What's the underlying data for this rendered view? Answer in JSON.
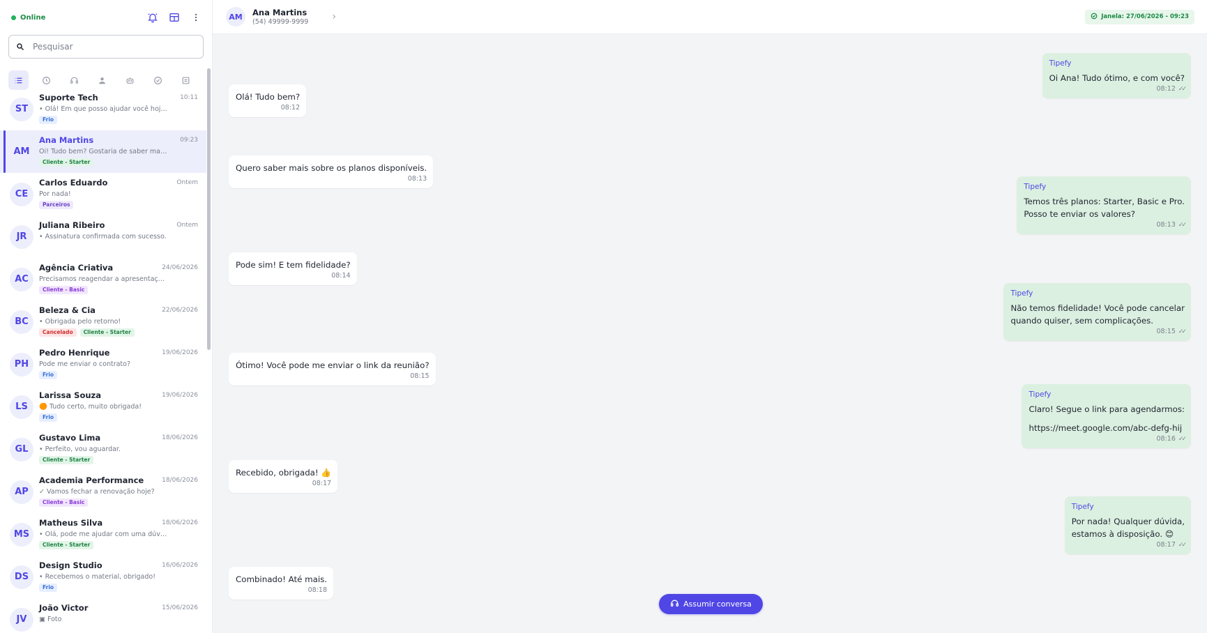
{
  "sidebar": {
    "status_label": "Online",
    "search_placeholder": "Pesquisar",
    "filter_icons": [
      "list-icon",
      "clock-icon",
      "headset-icon",
      "user-icon",
      "bot-icon",
      "check-circle-icon",
      "archive-icon"
    ],
    "conversations": [
      {
        "initials": "ST",
        "name": "Suporte Tech",
        "time": "10:11",
        "preview": "• Olá! Em que posso ajudar você hoje?",
        "tags": [
          {
            "label": "Frio",
            "kind": "frio"
          }
        ]
      },
      {
        "initials": "AM",
        "name": "Ana Martins",
        "time": "09:23",
        "preview": "Oi! Tudo bem? Gostaria de saber mais...",
        "tags": [
          {
            "label": "Cliente - Starter",
            "kind": "starter"
          }
        ],
        "active": true
      },
      {
        "initials": "CE",
        "name": "Carlos Eduardo",
        "time": "Ontem",
        "preview": "Por nada!",
        "tags": [
          {
            "label": "Parceiros",
            "kind": "parc"
          }
        ]
      },
      {
        "initials": "JR",
        "name": "Juliana Ribeiro",
        "time": "Ontem",
        "preview": "• Assinatura confirmada com sucesso.",
        "tags": []
      },
      {
        "initials": "AC",
        "name": "Agência Criativa",
        "time": "24/06/2026",
        "preview": "Precisamos reagendar a apresentação.",
        "tags": [
          {
            "label": "Cliente - Basic",
            "kind": "basic"
          }
        ]
      },
      {
        "initials": "BC",
        "name": "Beleza & Cia",
        "time": "22/06/2026",
        "preview": "• Obrigada pelo retorno!",
        "tags": [
          {
            "label": "Cancelado",
            "kind": "canc"
          },
          {
            "label": "Cliente - Starter",
            "kind": "starter"
          }
        ]
      },
      {
        "initials": "PH",
        "name": "Pedro Henrique",
        "time": "19/06/2026",
        "preview": "Pode me enviar o contrato?",
        "tags": [
          {
            "label": "Frio",
            "kind": "frio"
          }
        ]
      },
      {
        "initials": "LS",
        "name": "Larissa Souza",
        "time": "19/06/2026",
        "preview": "🟠 Tudo certo, muito obrigada!",
        "tags": [
          {
            "label": "Frio",
            "kind": "frio"
          }
        ]
      },
      {
        "initials": "GL",
        "name": "Gustavo Lima",
        "time": "18/06/2026",
        "preview": "• Perfeito, vou aguardar.",
        "tags": [
          {
            "label": "Cliente - Starter",
            "kind": "starter"
          }
        ]
      },
      {
        "initials": "AP",
        "name": "Academia Performance",
        "time": "18/06/2026",
        "preview": "✓ Vamos fechar a renovação hoje?",
        "tags": [
          {
            "label": "Cliente - Basic",
            "kind": "basic"
          }
        ]
      },
      {
        "initials": "MS",
        "name": "Matheus Silva",
        "time": "18/06/2026",
        "preview": "• Olá, pode me ajudar com uma dúvida?",
        "tags": [
          {
            "label": "Cliente - Starter",
            "kind": "starter"
          }
        ]
      },
      {
        "initials": "DS",
        "name": "Design Studio",
        "time": "16/06/2026",
        "preview": "• Recebemos o material, obrigado!",
        "tags": [
          {
            "label": "Frio",
            "kind": "frio"
          }
        ]
      },
      {
        "initials": "JV",
        "name": "João Victor",
        "time": "15/06/2026",
        "preview": "▣ Foto",
        "tags": []
      }
    ]
  },
  "header": {
    "initials": "AM",
    "name": "Ana Martins",
    "phone": "(54) 49999-9999",
    "window_label": "Janela: 27/06/2026 - 09:23"
  },
  "messages": [
    {
      "dir": "out",
      "sender": "Tipefy",
      "text": "Oi Ana! Tudo ótimo, e com você?",
      "time": "08:12"
    },
    {
      "dir": "in",
      "text": "Olá! Tudo bem?",
      "time": "08:12"
    },
    {
      "dir": "in",
      "text": "Quero saber mais sobre os planos disponíveis.",
      "time": "08:13"
    },
    {
      "dir": "out",
      "sender": "Tipefy",
      "text": "Temos três planos: Starter, Basic e Pro.\nPosso te enviar os valores?",
      "time": "08:13"
    },
    {
      "dir": "in",
      "text": "Pode sim! E tem fidelidade?",
      "time": "08:14"
    },
    {
      "dir": "out",
      "sender": "Tipefy",
      "text": "Não temos fidelidade! Você pode cancelar\nquando quiser, sem complicações.",
      "time": "08:15"
    },
    {
      "dir": "in",
      "text": "Ótimo! Você pode me enviar o link da reunião?",
      "time": "08:15"
    },
    {
      "dir": "out",
      "sender": "Tipefy",
      "text": "Claro! Segue o link para agendarmos:",
      "link": "https://meet.google.com/abc-defg-hij",
      "time": "08:16"
    },
    {
      "dir": "in",
      "text": "Recebido, obrigada! 👍",
      "time": "08:17"
    },
    {
      "dir": "out",
      "sender": "Tipefy",
      "text": "Por nada! Qualquer dúvida,\nestamos à disposição.  😊",
      "time": "08:17"
    },
    {
      "dir": "in",
      "text": "Combinado! Até mais.",
      "time": "08:18"
    }
  ],
  "take_over_label": "Assumir conversa",
  "colors": {
    "accent": "#5046e5",
    "online": "#22b35a",
    "outgoing_bubble": "#dcf0e1",
    "incoming_bubble": "#ffffff"
  }
}
